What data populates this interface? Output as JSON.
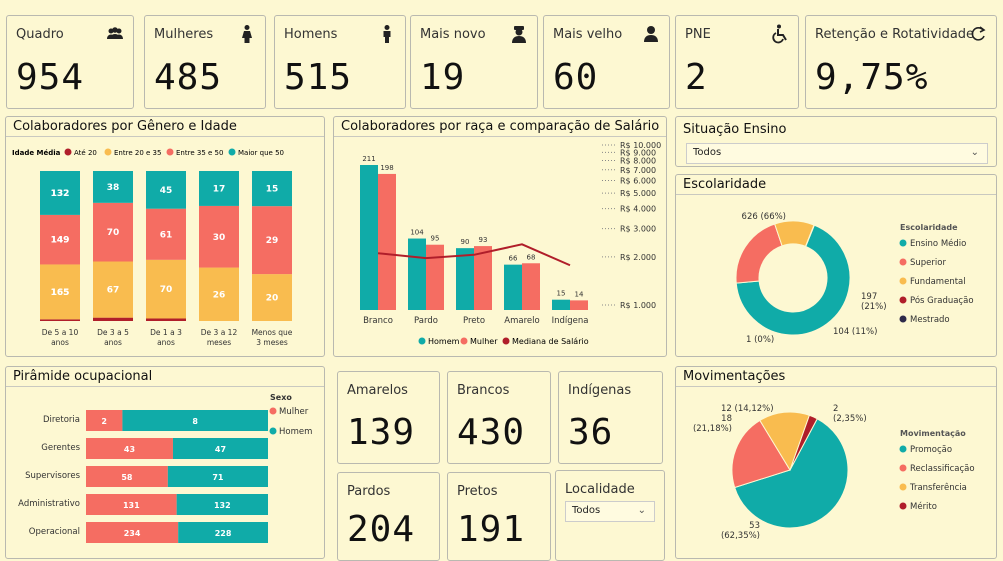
{
  "kpis": [
    {
      "label": "Quadro",
      "value": "954",
      "icon": "people-icon"
    },
    {
      "label": "Mulheres",
      "value": "485",
      "icon": "woman-icon"
    },
    {
      "label": "Homens",
      "value": "515",
      "icon": "man-icon"
    },
    {
      "label": "Mais novo",
      "value": "19",
      "icon": "young-person-icon"
    },
    {
      "label": "Mais velho",
      "value": "60",
      "icon": "old-person-icon"
    },
    {
      "label": "PNE",
      "value": "2",
      "icon": "wheelchair-icon"
    },
    {
      "label": "Retenção e Rotatividade",
      "value": "9,75%",
      "icon": "refresh-icon"
    }
  ],
  "panels": {
    "genero_idade": "Colaboradores por Gênero e Idade",
    "raca_salario": "Colaboradores por raça e comparação de Salário",
    "situacao": "Situação Ensino",
    "escolaridade": "Escolaridade",
    "piramide": "Pirâmide ocupacional",
    "movimentacoes": "Movimentações",
    "localidade": "Localidade"
  },
  "situacao_value": "Todos",
  "localidade_value": "Todos",
  "race_cards": [
    {
      "label": "Amarelos",
      "value": "139"
    },
    {
      "label": "Brancos",
      "value": "430"
    },
    {
      "label": "Indígenas",
      "value": "36"
    },
    {
      "label": "Pardos",
      "value": "204"
    },
    {
      "label": "Pretos",
      "value": "191"
    }
  ],
  "chart_data": [
    {
      "type": "bar",
      "id": "age",
      "stacked": true,
      "legend_title": "Idade Média",
      "categories": [
        "Até 20",
        "Entre 20 e 35",
        "Entre 35 e 50",
        "Maior que 50"
      ],
      "colors": [
        "#b01e2a",
        "#f9bc4f",
        "#f56d62",
        "#10aba8"
      ],
      "x": [
        "De 5 a 10 anos",
        "De 3 a 5 anos",
        "De 1 a 3 anos",
        "De 3 a 12 meses",
        "Menos que 3 meses"
      ],
      "x_lines": [
        [
          "De 5 a 10",
          "anos"
        ],
        [
          "De 3 a 5",
          "anos"
        ],
        [
          "De 1 a 3",
          "anos"
        ],
        [
          "De 3 a 12",
          "meses"
        ],
        [
          "Menos que",
          "3 meses"
        ]
      ],
      "series": [
        {
          "name": "Até 20",
          "values": [
            5,
            4,
            3,
            0,
            0
          ]
        },
        {
          "name": "Entre 20 e 35",
          "values": [
            165,
            67,
            70,
            26,
            20
          ]
        },
        {
          "name": "Entre 35 e 50",
          "values": [
            149,
            70,
            61,
            30,
            29
          ]
        },
        {
          "name": "Maior que 50",
          "values": [
            132,
            38,
            45,
            17,
            15
          ]
        }
      ],
      "labels": [
        [
          "",
          "",
          "",
          ""
        ],
        [
          "",
          "67",
          "70",
          "38"
        ],
        [
          "",
          "70",
          "61",
          "45"
        ],
        [
          "",
          "26",
          "30",
          "17"
        ],
        [
          "",
          "20",
          "29",
          "15"
        ]
      ]
    },
    {
      "type": "bar",
      "id": "raca",
      "categories": [
        "Branco",
        "Pardo",
        "Preto",
        "Amarelo",
        "Indígena"
      ],
      "series": [
        {
          "name": "Homem",
          "values": [
            211,
            104,
            90,
            66,
            15
          ],
          "color": "#10aba8"
        },
        {
          "name": "Mulher",
          "values": [
            198,
            95,
            93,
            68,
            14
          ],
          "color": "#f56d62"
        }
      ],
      "line": {
        "name": "Mediana de Salário",
        "values": [
          2200,
          2050,
          2150,
          2500,
          1850
        ],
        "color": "#b01e2a"
      },
      "y2_ticks": [
        "R$ 10.000",
        "R$ 9.000",
        "R$ 8.000",
        "R$ 7.000",
        "R$ 6.000",
        "R$ 5.000",
        "R$ 4.000",
        "R$ 3.000",
        "R$ 2.000",
        "R$ 1.000"
      ],
      "y2_values": [
        10000,
        9000,
        8000,
        7000,
        6000,
        5000,
        4000,
        3000,
        2000,
        1000
      ]
    },
    {
      "type": "pie",
      "id": "escolaridade",
      "donut": true,
      "legend_title": "Escolaridade",
      "categories": [
        "Ensino Médio",
        "Superior",
        "Fundamental",
        "Pós Graduação",
        "Mestrado"
      ],
      "values": [
        626,
        197,
        104,
        1,
        0
      ],
      "colors": [
        "#10aba8",
        "#f56d62",
        "#f9bc4f",
        "#b01e2a",
        "#2e2a4a"
      ],
      "data_labels": [
        "626 (66%)",
        "197\n(21%)",
        "104 (11%)",
        "1 (0%)",
        ""
      ]
    },
    {
      "type": "bar",
      "id": "piramide",
      "horizontal": true,
      "stacked": true,
      "legend_title": "Sexo",
      "categories": [
        "Diretoria",
        "Gerentes",
        "Supervisores",
        "Administrativo",
        "Operacional"
      ],
      "series": [
        {
          "name": "Mulher",
          "values": [
            2,
            43,
            58,
            131,
            234
          ],
          "color": "#f56d62"
        },
        {
          "name": "Homem",
          "values": [
            8,
            47,
            71,
            132,
            228
          ],
          "color": "#10aba8"
        }
      ]
    },
    {
      "type": "pie",
      "id": "movimentacao",
      "legend_title": "Movimentação",
      "categories": [
        "Promoção",
        "Reclassificação",
        "Transferência",
        "Mérito"
      ],
      "values": [
        53,
        18,
        12,
        2
      ],
      "colors": [
        "#10aba8",
        "#f56d62",
        "#f9bc4f",
        "#b01e2a"
      ],
      "data_labels": [
        "53\n(62,35%)",
        "18\n(21,18%)",
        "12 (14,12%)",
        "2\n(2,35%)"
      ]
    }
  ]
}
